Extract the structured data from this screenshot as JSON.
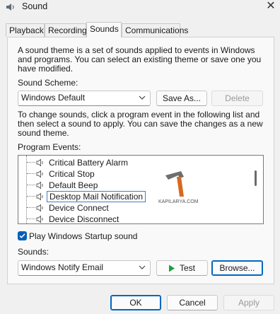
{
  "window": {
    "title": "Sound",
    "close_icon": "close-icon"
  },
  "tabs": [
    {
      "label": "Playback",
      "active": false
    },
    {
      "label": "Recording",
      "active": false
    },
    {
      "label": "Sounds",
      "active": true
    },
    {
      "label": "Communications",
      "active": false
    }
  ],
  "intro_text": [
    "A sound theme is a set of sounds applied to events in Windows",
    "and programs.  You can select an existing theme or save one you",
    "have modified."
  ],
  "scheme": {
    "label": "Sound Scheme:",
    "value": "Windows Default",
    "save_as_label": "Save As...",
    "delete_label": "Delete"
  },
  "instructions": [
    "To change sounds, click a program event in the following list and",
    "then select a sound to apply.  You can save the changes as a new",
    "sound theme."
  ],
  "events": {
    "label": "Program Events:",
    "items": [
      {
        "label": "Critical Battery Alarm",
        "selected": false
      },
      {
        "label": "Critical Stop",
        "selected": false
      },
      {
        "label": "Default Beep",
        "selected": false
      },
      {
        "label": "Desktop Mail Notification",
        "selected": true
      },
      {
        "label": "Device Connect",
        "selected": false
      },
      {
        "label": "Device Disconnect",
        "selected": false
      }
    ],
    "watermark": "KAPILARYA.COM"
  },
  "startup": {
    "label": "Play Windows Startup sound",
    "checked": true
  },
  "sounds": {
    "label": "Sounds:",
    "value": "Windows Notify Email",
    "test_label": "Test",
    "browse_label": "Browse..."
  },
  "footer": {
    "ok_label": "OK",
    "cancel_label": "Cancel",
    "apply_label": "Apply"
  },
  "colors": {
    "accent": "#005fb8",
    "test_arrow": "#1f9e3a",
    "selection_border": "#4a78c8"
  }
}
